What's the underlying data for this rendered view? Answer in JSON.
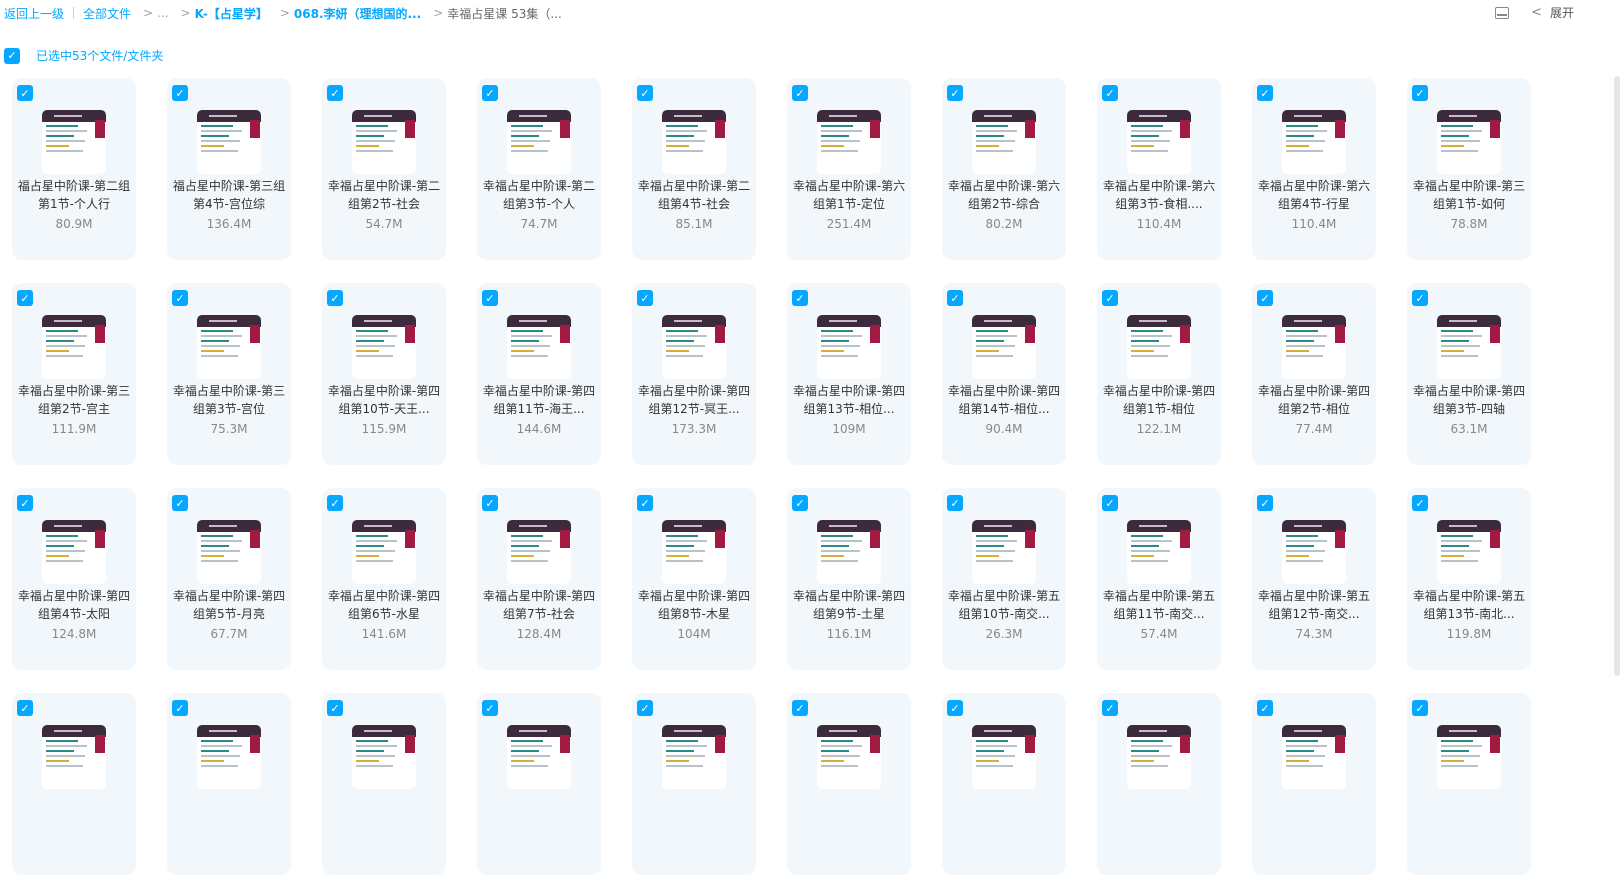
{
  "breadcrumb": {
    "back": "返回上一级",
    "all_files": "全部文件",
    "ellipsis": "...",
    "level1": "K-【占星学】",
    "level2": "068.李妍（理想国的...",
    "current": "幸福占星课 53集（..."
  },
  "toolbar": {
    "expand_label": "展开"
  },
  "selection": {
    "label": "已选中53个文件/文件夹"
  },
  "icons": {
    "checkbox": "checkmark-icon",
    "panel": "panel-icon",
    "collapse": "chevron-left-icon"
  },
  "colors": {
    "accent": "#06a7ff",
    "card_bg": "#f2f7fc"
  },
  "files": [
    {
      "name": "福占星中阶课-第二组第1节-个人行",
      "size": "80.9M"
    },
    {
      "name": "福占星中阶课-第三组第4节-宫位综",
      "size": "136.4M"
    },
    {
      "name": "幸福占星中阶课-第二组第2节-社会",
      "size": "54.7M"
    },
    {
      "name": "幸福占星中阶课-第二组第3节-个人",
      "size": "74.7M"
    },
    {
      "name": "幸福占星中阶课-第二组第4节-社会",
      "size": "85.1M"
    },
    {
      "name": "幸福占星中阶课-第六组第1节-定位",
      "size": "251.4M"
    },
    {
      "name": "幸福占星中阶课-第六组第2节-综合",
      "size": "80.2M"
    },
    {
      "name": "幸福占星中阶课-第六组第3节-食相....",
      "size": "110.4M"
    },
    {
      "name": "幸福占星中阶课-第六组第4节-行星",
      "size": "110.4M"
    },
    {
      "name": "幸福占星中阶课-第三组第1节-如何",
      "size": "78.8M"
    },
    {
      "name": "幸福占星中阶课-第三组第2节-宫主",
      "size": "111.9M"
    },
    {
      "name": "幸福占星中阶课-第三组第3节-宫位",
      "size": "75.3M"
    },
    {
      "name": "幸福占星中阶课-第四组第10节-天王...",
      "size": "115.9M"
    },
    {
      "name": "幸福占星中阶课-第四组第11节-海王...",
      "size": "144.6M"
    },
    {
      "name": "幸福占星中阶课-第四组第12节-冥王...",
      "size": "173.3M"
    },
    {
      "name": "幸福占星中阶课-第四组第13节-相位...",
      "size": "109M"
    },
    {
      "name": "幸福占星中阶课-第四组第14节-相位...",
      "size": "90.4M"
    },
    {
      "name": "幸福占星中阶课-第四组第1节-相位",
      "size": "122.1M"
    },
    {
      "name": "幸福占星中阶课-第四组第2节-相位",
      "size": "77.4M"
    },
    {
      "name": "幸福占星中阶课-第四组第3节-四轴",
      "size": "63.1M"
    },
    {
      "name": "幸福占星中阶课-第四组第4节-太阳",
      "size": "124.8M"
    },
    {
      "name": "幸福占星中阶课-第四组第5节-月亮",
      "size": "67.7M"
    },
    {
      "name": "幸福占星中阶课-第四组第6节-水星",
      "size": "141.6M"
    },
    {
      "name": "幸福占星中阶课-第四组第7节-社会",
      "size": "128.4M"
    },
    {
      "name": "幸福占星中阶课-第四组第8节-木星",
      "size": "104M"
    },
    {
      "name": "幸福占星中阶课-第四组第9节-土星",
      "size": "116.1M"
    },
    {
      "name": "幸福占星中阶课-第五组第10节-南交...",
      "size": "26.3M"
    },
    {
      "name": "幸福占星中阶课-第五组第11节-南交...",
      "size": "57.4M"
    },
    {
      "name": "幸福占星中阶课-第五组第12节-南交...",
      "size": "74.3M"
    },
    {
      "name": "幸福占星中阶课-第五组第13节-南北...",
      "size": "119.8M"
    },
    {
      "name": "",
      "size": ""
    },
    {
      "name": "",
      "size": ""
    },
    {
      "name": "",
      "size": ""
    },
    {
      "name": "",
      "size": ""
    },
    {
      "name": "",
      "size": ""
    },
    {
      "name": "",
      "size": ""
    },
    {
      "name": "",
      "size": ""
    },
    {
      "name": "",
      "size": ""
    },
    {
      "name": "",
      "size": ""
    },
    {
      "name": "",
      "size": ""
    }
  ]
}
